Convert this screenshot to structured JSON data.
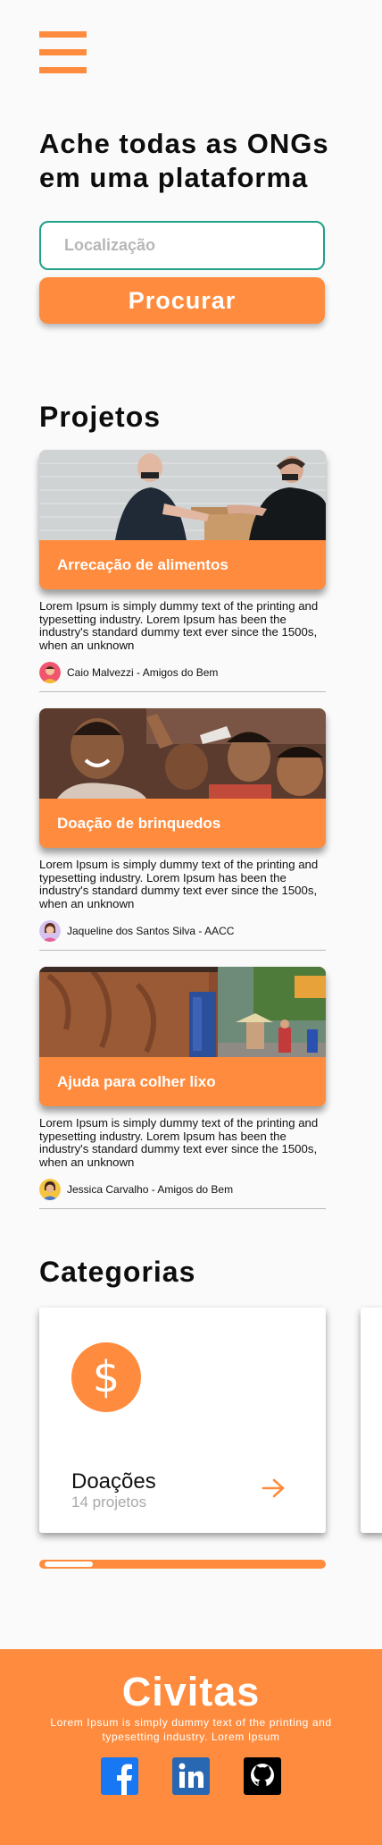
{
  "header": {
    "menu_icon": "hamburger-menu-icon"
  },
  "hero": {
    "title_line1": "Ache todas as ONGs",
    "title_line2": "em uma plataforma",
    "search_placeholder": "Localização",
    "search_value": "",
    "search_button": "Procurar"
  },
  "projects": {
    "title": "Projetos",
    "items": [
      {
        "label": "Arrecação de alimentos",
        "description": "Lorem Ipsum is simply dummy text of the printing and typesetting industry. Lorem Ipsum has been the industry's standard dummy text ever since the 1500s, when an unknown",
        "author": "Caio Malvezzi - Amigos do Bem"
      },
      {
        "label": "Doação de brinquedos",
        "description": "Lorem Ipsum is simply dummy text of the printing and typesetting industry. Lorem Ipsum has been the industry's standard dummy text ever since the 1500s, when an unknown",
        "author": "Jaqueline dos Santos Silva - AACC"
      },
      {
        "label": "Ajuda para colher lixo",
        "description": "Lorem Ipsum is simply dummy text of the printing and typesetting industry. Lorem Ipsum has been the industry's standard dummy text ever since the 1500s, when an unknown",
        "author": "Jessica Carvalho - Amigos do Bem"
      }
    ]
  },
  "categories": {
    "title": "Categorias",
    "items": [
      {
        "icon": "dollar-icon",
        "icon_glyph": "$",
        "name": "Doações",
        "count": "14 projetos"
      }
    ]
  },
  "footer": {
    "brand": "Civitas",
    "text": "Lorem Ipsum is simply dummy text of the printing and typesetting industry. Lorem Ipsum",
    "social": [
      "facebook-icon",
      "linkedin-icon",
      "github-icon"
    ]
  },
  "colors": {
    "accent": "#ff8c3e",
    "input_border": "#21a08a",
    "background": "#fafafa",
    "facebook": "#1877f2",
    "linkedin": "#2867b2"
  }
}
